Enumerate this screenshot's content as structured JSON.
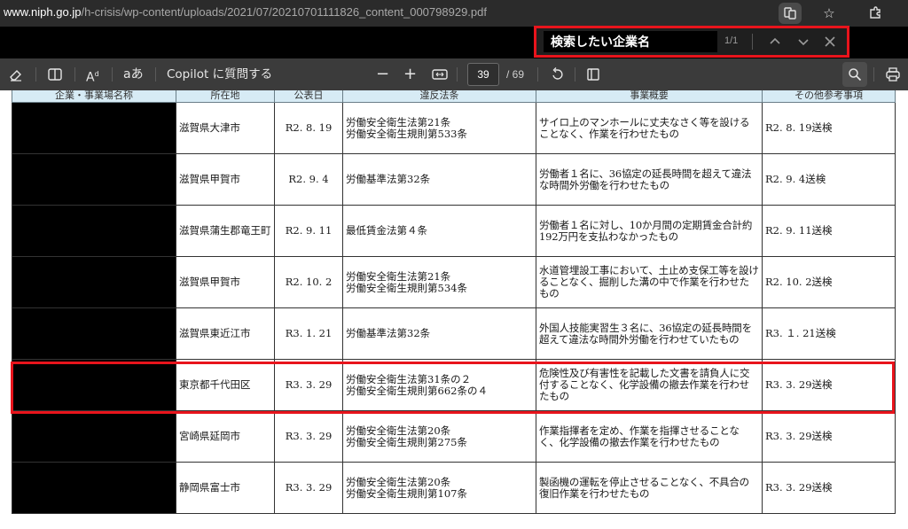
{
  "address_bar": {
    "url_host": "www.niph.go.jp",
    "url_path": "/h-crisis/wp-content/uploads/2021/07/20210701111826_content_000798929.pdf"
  },
  "find_bar": {
    "query": "検索したい企業名",
    "match_count": "1/1"
  },
  "pdf_toolbar": {
    "copilot_label": "Copilot に質問する",
    "zoom_out": "−",
    "zoom_in": "+",
    "current_page": "39",
    "total_pages": "/ 69"
  },
  "table": {
    "headers": [
      "企業・事業場名称",
      "所在地",
      "公表日",
      "違反法条",
      "事業概要",
      "その他参考事項"
    ],
    "rows": [
      {
        "location": "滋賀県大津市",
        "date": "R2. 8. 19",
        "law": [
          "労働安全衛生法第21条",
          "労働安全衛生規則第533条"
        ],
        "summary": "サイロ上のマンホールに丈夫なさく等を設けることなく、作業を行わせたもの",
        "ref": "R2. 8. 19送検"
      },
      {
        "location": "滋賀県甲賀市",
        "date": "R2. 9. 4",
        "law": [
          "労働基準法第32条"
        ],
        "summary": "労働者１名に、36協定の延長時間を超えて違法な時間外労働を行わせたもの",
        "ref": "R2. 9. 4送検"
      },
      {
        "location": "滋賀県蒲生郡竜王町",
        "date": "R2. 9. 11",
        "law": [
          "最低賃金法第４条"
        ],
        "summary": "労働者１名に対し、10か月間の定期賃金合計約192万円を支払わなかったもの",
        "ref": "R2. 9. 11送検"
      },
      {
        "location": "滋賀県甲賀市",
        "date": "R2. 10. 2",
        "law": [
          "労働安全衛生法第21条",
          "労働安全衛生規則第534条"
        ],
        "summary": "水道管埋設工事において、土止め支保工等を設けることなく、掘削した溝の中で作業を行わせたもの",
        "ref": "R2. 10. 2送検"
      },
      {
        "location": "滋賀県東近江市",
        "date": "R3. 1. 21",
        "law": [
          "労働基準法第32条"
        ],
        "summary": "外国人技能実習生３名に、36協定の延長時間を超えて違法な時間外労働を行わせていたもの",
        "ref": "R3. １. 21送検"
      },
      {
        "location": "東京都千代田区",
        "date": "R3. 3. 29",
        "law": [
          "労働安全衛生法第31条の２",
          "労働安全衛生規則第662条の４"
        ],
        "summary": "危険性及び有害性を記載した文書を請負人に交付することなく、化学設備の撤去作業を行わせたもの",
        "ref": "R3. 3. 29送検"
      },
      {
        "location": "宮崎県延岡市",
        "date": "R3. 3. 29",
        "law": [
          "労働安全衛生法第20条",
          "労働安全衛生規則第275条"
        ],
        "summary": "作業指揮者を定め、作業を指揮させることなく、化学設備の撤去作業を行わせたもの",
        "ref": "R3. 3. 29送検"
      },
      {
        "location": "静岡県富士市",
        "date": "R3. 3. 29",
        "law": [
          "労働安全衛生法第20条",
          "労働安全衛生規則第107条"
        ],
        "summary": "製函機の運転を停止させることなく、不具合の復旧作業を行わせたもの",
        "ref": "R3. 3. 29送検"
      }
    ]
  },
  "colors": {
    "highlight": "#e8141c",
    "header_bg": "#d7ebf5"
  },
  "icons": {
    "address_bar": [
      "reading-mode-icon",
      "favorite-star-icon",
      "extensions-icon"
    ],
    "find_bar": [
      "chevron-up-icon",
      "chevron-down-icon",
      "close-icon"
    ],
    "toolbar": [
      "eraser-icon",
      "reader-icon",
      "read-aloud-icon",
      "translate-icon",
      "fit-page-icon",
      "rotate-icon",
      "page-view-icon",
      "search-icon",
      "print-icon"
    ]
  }
}
